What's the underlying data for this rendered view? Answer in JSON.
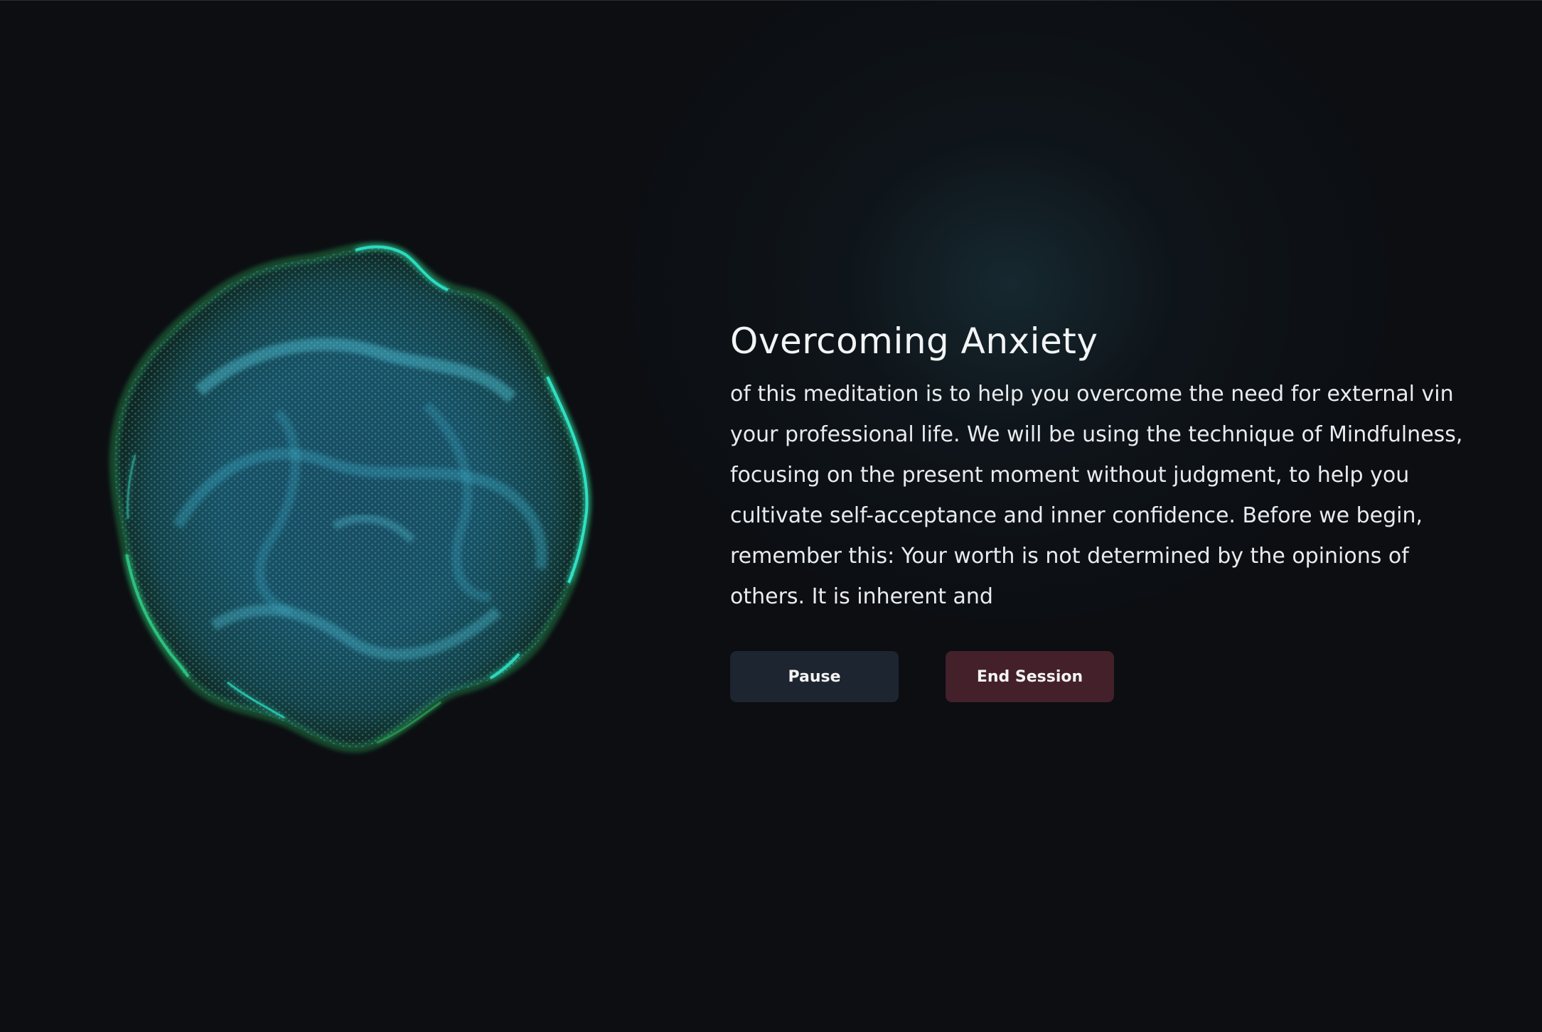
{
  "session": {
    "title": "Overcoming Anxiety",
    "transcript": "of this meditation is to help you overcome the need for external vin your professional life. We will be using the technique of Mindfulness, focusing on the present moment without judgment, to help you cultivate self-acceptance and inner confidence. Before we begin, remember this: Your worth is not determined by the opinions of others. It is inherent and"
  },
  "controls": {
    "pause_label": "Pause",
    "end_label": "End Session"
  },
  "visualizer": {
    "icon": "breathing-orb-visualizer",
    "core_color": "#1e6e8c",
    "glow_color": "#2ee6c8",
    "edge_color": "#2fae5a"
  },
  "colors": {
    "background": "#0c0e12",
    "pause_button": "#1d2530",
    "end_button": "#43202a",
    "text": "#e9ecee"
  }
}
